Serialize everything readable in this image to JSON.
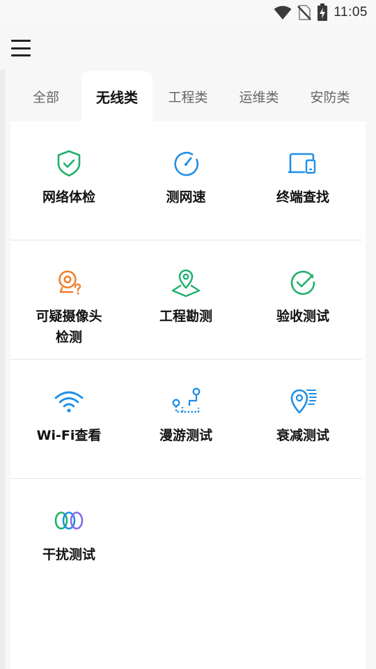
{
  "status_bar": {
    "time": "11:05",
    "icons": [
      "wifi-icon",
      "no-sim-icon",
      "battery-charging-icon"
    ]
  },
  "header": {
    "menu_icon": "hamburger-menu-icon"
  },
  "tabs": [
    {
      "label": "全部",
      "active": false
    },
    {
      "label": "无线类",
      "active": true
    },
    {
      "label": "工程类",
      "active": false
    },
    {
      "label": "运维类",
      "active": false
    },
    {
      "label": "安防类",
      "active": false
    }
  ],
  "tools": [
    {
      "label": "网络体检",
      "icon": "shield-check-icon",
      "color": "#1eb069"
    },
    {
      "label": "测网速",
      "icon": "speedometer-icon",
      "color": "#1f8fe8"
    },
    {
      "label": "终端查找",
      "icon": "devices-icon",
      "color": "#1f8fe8"
    },
    {
      "label": "可疑摄像头\n检测",
      "icon": "camera-question-icon",
      "color": "#f07c2a"
    },
    {
      "label": "工程勘测",
      "icon": "map-pin-icon",
      "color": "#1eb069"
    },
    {
      "label": "验收测试",
      "icon": "check-circle-icon",
      "color": "#1eb069"
    },
    {
      "label": "Wi-Fi查看",
      "icon": "wifi-icon",
      "color": "#1f8fe8"
    },
    {
      "label": "漫游测试",
      "icon": "roaming-path-icon",
      "color": "#1f8fe8"
    },
    {
      "label": "衰减测试",
      "icon": "signal-attenuation-icon",
      "color": "#1f8fe8"
    },
    {
      "label": "干扰测试",
      "icon": "interference-rings-icon",
      "color": "#1eb069"
    }
  ]
}
